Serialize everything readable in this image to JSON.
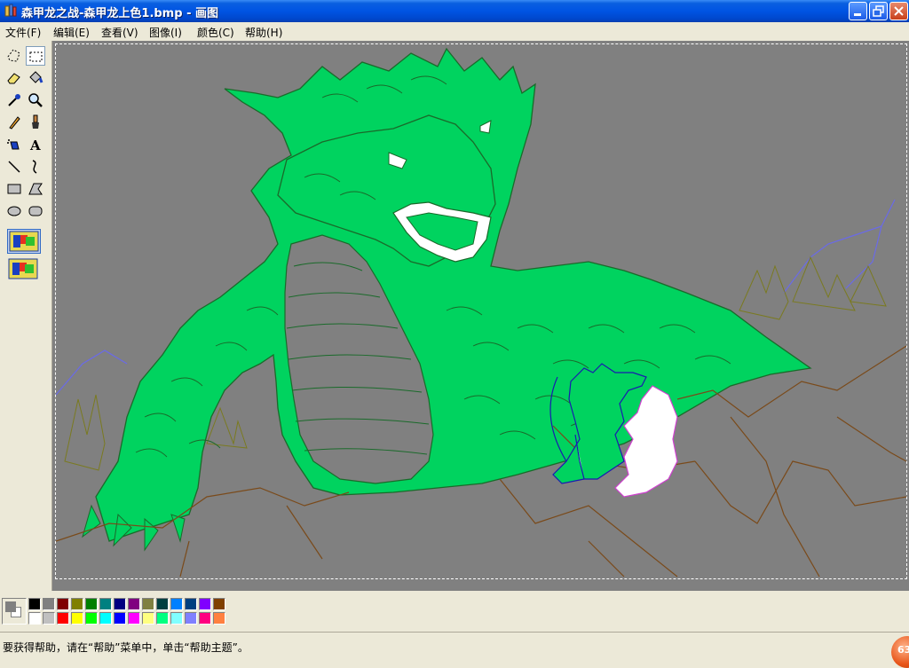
{
  "window": {
    "title": "森甲龙之战-森甲龙上色1.bmp - 画图",
    "minimize_icon": "minimize-icon",
    "maximize_icon": "restore-icon",
    "close_icon": "close-icon"
  },
  "menu": {
    "items": [
      "文件(F)",
      "编辑(E)",
      "查看(V)",
      "图像(I)",
      "颜色(C)",
      "帮助(H)"
    ]
  },
  "toolbox": {
    "tools": [
      "free-select",
      "rect-select",
      "eraser",
      "fill",
      "color-picker",
      "magnifier",
      "pencil",
      "brush",
      "airbrush",
      "text",
      "line",
      "curve",
      "rectangle",
      "polygon",
      "ellipse",
      "rounded-rectangle"
    ],
    "selected_tool": "rect-select",
    "text_tool_glyph": "A",
    "options": [
      "opaque-background",
      "transparent-background"
    ],
    "selected_option": "opaque-background"
  },
  "palette": {
    "foreground": "#808080",
    "background": "#ffffff",
    "colors_row1": [
      "#000000",
      "#808080",
      "#800000",
      "#808000",
      "#008000",
      "#008080",
      "#000080",
      "#800080",
      "#808040",
      "#004040",
      "#0080ff",
      "#004080",
      "#8000ff",
      "#804000"
    ],
    "colors_row2": [
      "#ffffff",
      "#c0c0c0",
      "#ff0000",
      "#ffff00",
      "#00ff00",
      "#00ffff",
      "#0000ff",
      "#ff00ff",
      "#ffff80",
      "#00ff80",
      "#80ffff",
      "#8080ff",
      "#ff0080",
      "#ff8040"
    ]
  },
  "canvas": {
    "background": "#808080",
    "dragon_fill": "#00d35f",
    "dragon_outline": "#1a6a2a",
    "ground_color": "#7a4a1a",
    "tree_color": "#7a7a20",
    "lightning_color": "#6a6ae8"
  },
  "status": {
    "text": "要获得帮助，请在“帮助”菜单中，单击“帮助主题”。",
    "badge": "63"
  }
}
